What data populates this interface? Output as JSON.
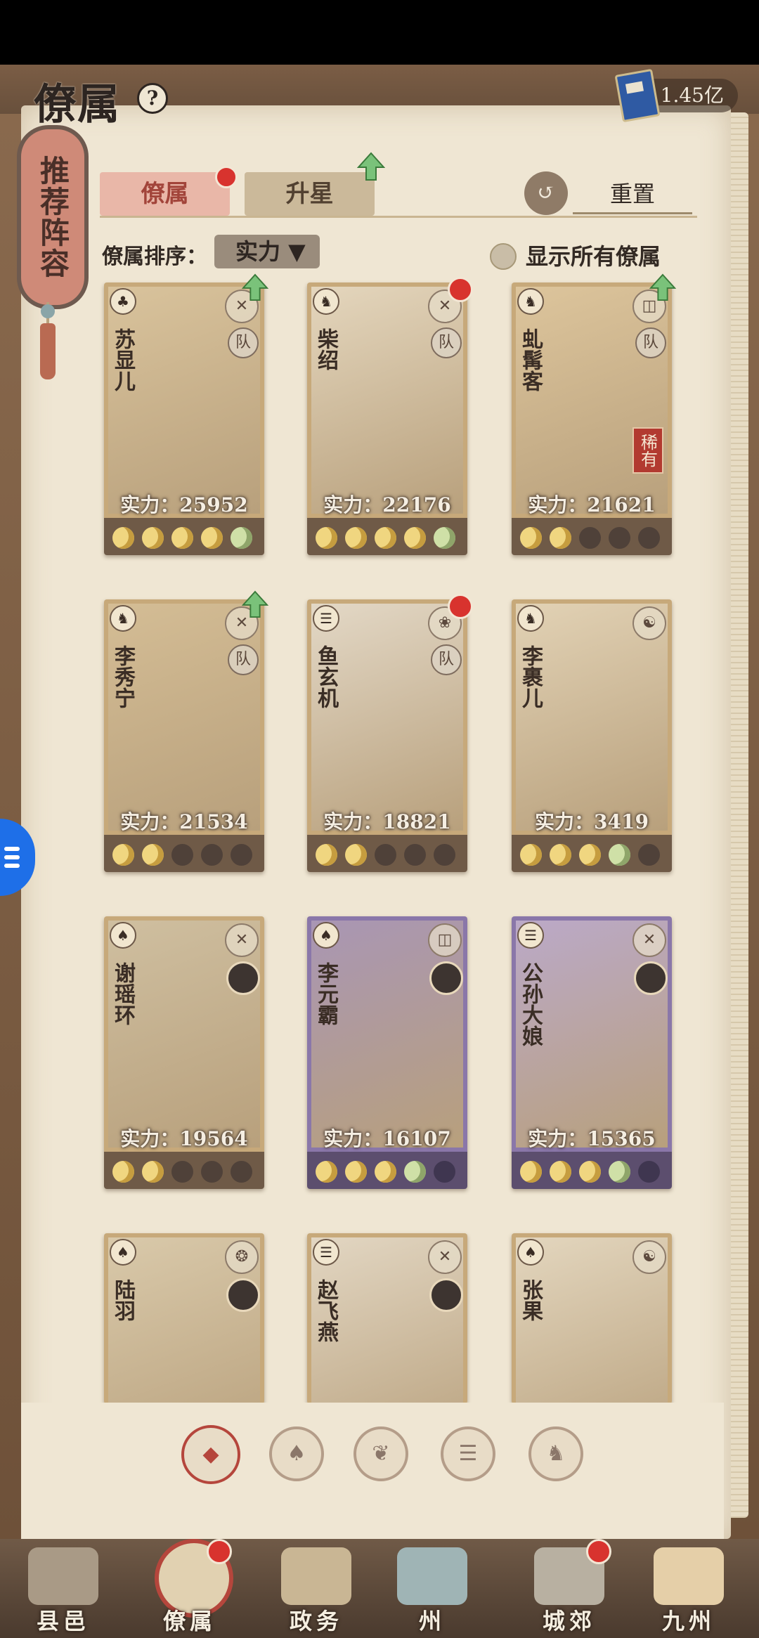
{
  "header": {
    "title": "僚属",
    "currency_value": "1.45亿"
  },
  "recommend_label": "推荐阵容",
  "tabs": [
    {
      "label": "僚属",
      "active": true
    },
    {
      "label": "升星",
      "active": false
    }
  ],
  "reset_label": "重置",
  "sort": {
    "label": "僚属排序：",
    "value": "实力"
  },
  "show_all_label": "显示所有僚属",
  "cards": [
    {
      "name": "苏显儿",
      "power": "实力：25952",
      "team": "队",
      "frame": "gold",
      "moons": [
        "on",
        "on",
        "on",
        "on",
        "half"
      ],
      "badge": "up"
    },
    {
      "name": "柴绍",
      "power": "实力：22176",
      "team": "队",
      "frame": "gold",
      "moons": [
        "on",
        "on",
        "on",
        "on",
        "half"
      ],
      "badge": "dot"
    },
    {
      "name": "虬髯客",
      "power": "实力：21621",
      "team": "队",
      "frame": "gold",
      "moons": [
        "on",
        "on",
        "off",
        "off",
        "off"
      ],
      "badge": "up",
      "rare": "稀有"
    },
    {
      "name": "李秀宁",
      "power": "实力：21534",
      "team": "队",
      "frame": "gold",
      "moons": [
        "on",
        "on",
        "off",
        "off",
        "off"
      ],
      "badge": "up"
    },
    {
      "name": "鱼玄机",
      "power": "实力：18821",
      "team": "队",
      "frame": "gold",
      "moons": [
        "on",
        "on",
        "off",
        "off",
        "off"
      ],
      "badge": "dot"
    },
    {
      "name": "李裹儿",
      "power": "实力：3419",
      "team": "",
      "frame": "gold",
      "moons": [
        "on",
        "on",
        "on",
        "half",
        "off"
      ],
      "badge": ""
    },
    {
      "name": "谢瑶环",
      "power": "实力：19564",
      "team": "",
      "frame": "gold",
      "moons": [
        "on",
        "on",
        "off",
        "off",
        "off"
      ],
      "badge": "",
      "avatar": true
    },
    {
      "name": "李元霸",
      "power": "实力：16107",
      "team": "",
      "frame": "purple",
      "moons": [
        "on",
        "on",
        "on",
        "half",
        "off"
      ],
      "badge": "",
      "avatar": true
    },
    {
      "name": "公孙大娘",
      "power": "实力：15365",
      "team": "",
      "frame": "purple",
      "moons": [
        "on",
        "on",
        "on",
        "half",
        "off"
      ],
      "badge": "",
      "avatar": true
    },
    {
      "name": "陆羽",
      "power": "",
      "team": "",
      "frame": "gold",
      "moons": [],
      "badge": "",
      "avatar": true
    },
    {
      "name": "赵飞燕",
      "power": "",
      "team": "",
      "frame": "gold",
      "moons": [],
      "badge": "",
      "avatar": true
    },
    {
      "name": "张果",
      "power": "",
      "team": "",
      "frame": "gold",
      "moons": [],
      "badge": ""
    }
  ],
  "filters": [
    "all-filter-icon",
    "bell-filter-icon",
    "rabbit-filter-icon",
    "fan-filter-icon",
    "beast-filter-icon"
  ],
  "bottom_nav": [
    {
      "label": "县邑",
      "dot": false
    },
    {
      "label": "僚属",
      "dot": true,
      "active": true
    },
    {
      "label": "政务",
      "dot": false
    },
    {
      "label": "州",
      "dot": false
    },
    {
      "label": "城郊",
      "dot": true
    },
    {
      "label": "九州",
      "dot": false
    }
  ],
  "colors": {
    "accent_red": "#d8332e",
    "paper": "#efe6d3",
    "frame_gold": "#c7a97a",
    "frame_purple": "#8a77a9"
  }
}
